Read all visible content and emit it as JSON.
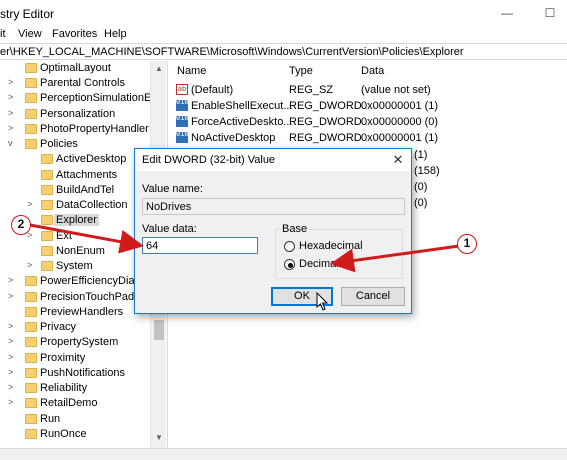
{
  "window": {
    "title": "stry Editor",
    "minimize_glyph": "—",
    "maximize_glyph": "☐"
  },
  "menu": {
    "items": [
      "it",
      "View",
      "Favorites",
      "Help"
    ]
  },
  "address": {
    "path": "er\\HKEY_LOCAL_MACHINE\\SOFTWARE\\Microsoft\\Windows\\CurrentVersion\\Policies\\Explorer"
  },
  "tree": {
    "items": [
      {
        "label": "OptimalLayout",
        "expander": ""
      },
      {
        "label": "Parental Controls",
        "expander": ">"
      },
      {
        "label": "PerceptionSimulationExt",
        "expander": ">"
      },
      {
        "label": "Personalization",
        "expander": ">"
      },
      {
        "label": "PhotoPropertyHandler",
        "expander": ">"
      },
      {
        "label": "Policies",
        "expander": "v"
      },
      {
        "label": "ActiveDesktop",
        "expander": ""
      },
      {
        "label": "Attachments",
        "expander": ""
      },
      {
        "label": "BuildAndTel",
        "expander": ""
      },
      {
        "label": "DataCollection",
        "expander": ">"
      },
      {
        "label": "Explorer",
        "expander": ""
      },
      {
        "label": "Ext",
        "expander": ">"
      },
      {
        "label": "NonEnum",
        "expander": ""
      },
      {
        "label": "System",
        "expander": ">"
      },
      {
        "label": "PowerEfficiencyDiagn",
        "expander": ">"
      },
      {
        "label": "PrecisionTouchPad",
        "expander": ">"
      },
      {
        "label": "PreviewHandlers",
        "expander": ""
      },
      {
        "label": "Privacy",
        "expander": ">"
      },
      {
        "label": "PropertySystem",
        "expander": ">"
      },
      {
        "label": "Proximity",
        "expander": ">"
      },
      {
        "label": "PushNotifications",
        "expander": ">"
      },
      {
        "label": "Reliability",
        "expander": ">"
      },
      {
        "label": "RetailDemo",
        "expander": ">"
      },
      {
        "label": "Run",
        "expander": ""
      },
      {
        "label": "RunOnce",
        "expander": ""
      }
    ],
    "selected": "Explorer"
  },
  "values_pane": {
    "columns": {
      "name": "Name",
      "type": "Type",
      "data": "Data"
    },
    "rows": [
      {
        "icon": "ab",
        "name": "(Default)",
        "type": "REG_SZ",
        "data": "(value not set)"
      },
      {
        "icon": "010",
        "name": "EnableShellExecut...",
        "type": "REG_DWORD",
        "data": "0x00000001 (1)"
      },
      {
        "icon": "010",
        "name": "ForceActiveDeskto...",
        "type": "REG_DWORD",
        "data": "0x00000000 (0)"
      },
      {
        "icon": "010",
        "name": "NoActiveDesktop",
        "type": "REG_DWORD",
        "data": "0x00000001 (1)"
      }
    ],
    "partial_data": [
      "(1)",
      "(158)",
      "(0)",
      "(0)"
    ]
  },
  "dialog": {
    "title": "Edit DWORD (32-bit) Value",
    "close_glyph": "✕",
    "value_name_label": "Value name:",
    "value_name": "NoDrives",
    "value_data_label": "Value data:",
    "value_data": "64",
    "base_label": "Base",
    "hex_label": "Hexadecimal",
    "dec_label": "Decimal",
    "base_selected": "Decimal",
    "ok_label": "OK",
    "cancel_label": "Cancel"
  },
  "annotations": {
    "badge_1": "1",
    "badge_2": "2",
    "arrow_color": "#d11a1a"
  }
}
